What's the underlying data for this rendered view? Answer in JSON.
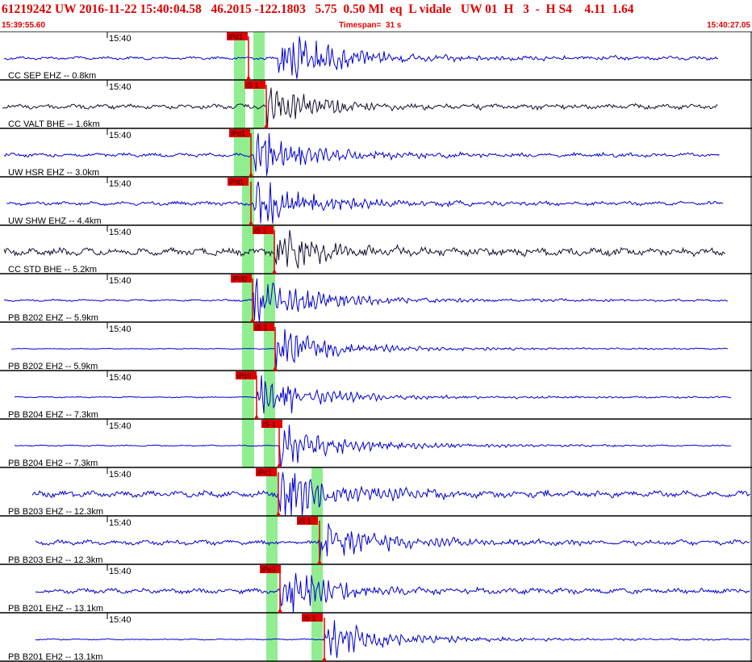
{
  "header": {
    "title": "61219242 UW 2016-11-22 15:40:04.58   46.2015 -122.1803   5.75  0.50 Ml  eq  L vidale   UW 01  H   3  -  H S4    4.11  1.64",
    "start_time": "15:39:55.60",
    "timespan": "Timespan=  31 s",
    "end_time": "15:40:27.05"
  },
  "colors": {
    "trace_blue": "#0000d0",
    "trace_black": "#101030",
    "pick_red": "#e00000",
    "window_green": "#90ee90",
    "header_red": "#e00000"
  },
  "traces": [
    {
      "label": "CC SEP EHZ -- 0.8km",
      "time_tick": "15:40",
      "color": "blue",
      "picks": [
        "iPd1"
      ],
      "green_windows": 2,
      "pick_labels_arrival": "P"
    },
    {
      "label": "CC VALT BHE -- 1.6km",
      "time_tick": "15:40",
      "color": "black",
      "picks": [
        "iS 1"
      ]
    },
    {
      "label": "UW HSR EHZ -- 3.0km",
      "time_tick": "15:40",
      "color": "blue",
      "picks": [
        "iPd1"
      ]
    },
    {
      "label": "UW SHW EHZ -- 4.4km",
      "time_tick": "15:40",
      "color": "blue",
      "picks": [
        "iPd1"
      ]
    },
    {
      "label": "CC STD BHE -- 5.2km",
      "time_tick": "15:40",
      "color": "black",
      "picks": [
        "iS 1"
      ]
    },
    {
      "label": "PB B202 EHZ -- 5.9km",
      "time_tick": "15:40",
      "color": "blue",
      "picks": [
        "iPd0"
      ]
    },
    {
      "label": "PB B202 EH2 -- 5.9km",
      "time_tick": "15:40",
      "color": "blue",
      "picks": [
        "iS 1"
      ]
    },
    {
      "label": "PB B204 EHZ -- 7.3km",
      "time_tick": "15:40",
      "color": "blue",
      "picks": [
        "iPc0"
      ]
    },
    {
      "label": "PB B204 EH2 -- 7.3km",
      "time_tick": "15:40",
      "color": "blue",
      "picks": [
        "iS 1"
      ]
    },
    {
      "label": "PB B203 EHZ -- 12.3km",
      "time_tick": "15:40",
      "color": "blue",
      "picks": [
        "iPc1"
      ]
    },
    {
      "label": "PB B203 EH2 -- 12.3km",
      "time_tick": "15:40",
      "color": "blue",
      "picks": [
        "iS 1"
      ]
    },
    {
      "label": "PB B201 EHZ -- 13.1km",
      "time_tick": "15:40",
      "color": "blue",
      "picks": [
        "iPc0"
      ]
    },
    {
      "label": "PB B201 EH2 -- 13.1km",
      "time_tick": "15:40",
      "color": "blue",
      "picks": [
        "iS 1"
      ]
    }
  ]
}
